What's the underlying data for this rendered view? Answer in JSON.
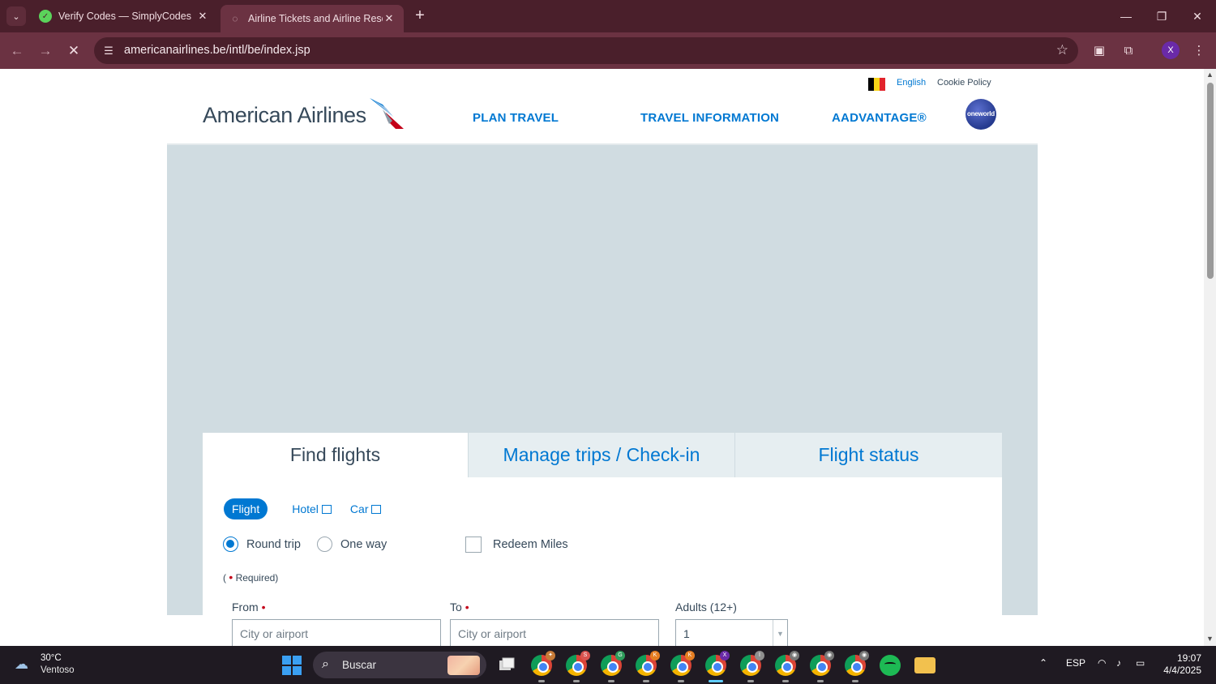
{
  "browser": {
    "tabs": [
      {
        "title": "Verify Codes — SimplyCodes",
        "active": false
      },
      {
        "title": "Airline Tickets and Airline Reser",
        "active": true
      }
    ],
    "url": "americanairlines.be/intl/be/index.jsp"
  },
  "page": {
    "utility": {
      "language": "English",
      "cookie_policy": "Cookie Policy"
    },
    "logo_text": "American Airlines",
    "nav": [
      {
        "label": "PLAN TRAVEL"
      },
      {
        "label": "TRAVEL INFORMATION"
      },
      {
        "label": "AADVANTAGE®"
      }
    ],
    "oneworld": "oneworld",
    "booking": {
      "tabs": [
        {
          "label": "Find flights",
          "active": true
        },
        {
          "label": "Manage trips / Check-in",
          "active": false
        },
        {
          "label": "Flight status",
          "active": false
        }
      ],
      "product_tabs": {
        "flight": "Flight",
        "hotel": "Hotel",
        "car": "Car"
      },
      "trip_type": {
        "round_trip": "Round trip",
        "one_way": "One way",
        "selected": "Round trip"
      },
      "redeem_miles": "Redeem Miles",
      "required_open": "(",
      "required_label": "Required)",
      "from_label": "From",
      "to_label": "To",
      "adults_label": "Adults (12+)",
      "from_placeholder": "City or airport",
      "to_placeholder": "City or airport",
      "adults_value": "1"
    }
  },
  "taskbar": {
    "weather": {
      "temp": "30°C",
      "condition": "Ventoso"
    },
    "search_label": "Buscar",
    "language": "ESP",
    "time": "19:07",
    "date": "4/4/2025"
  },
  "colors": {
    "brand_blue": "#0078d2",
    "brand_text": "#36495a",
    "hero_bg": "#d0dce1",
    "chrome_dark": "#4a1f2b",
    "chrome_toolbar": "#6b3242",
    "required_red": "#c30019"
  }
}
